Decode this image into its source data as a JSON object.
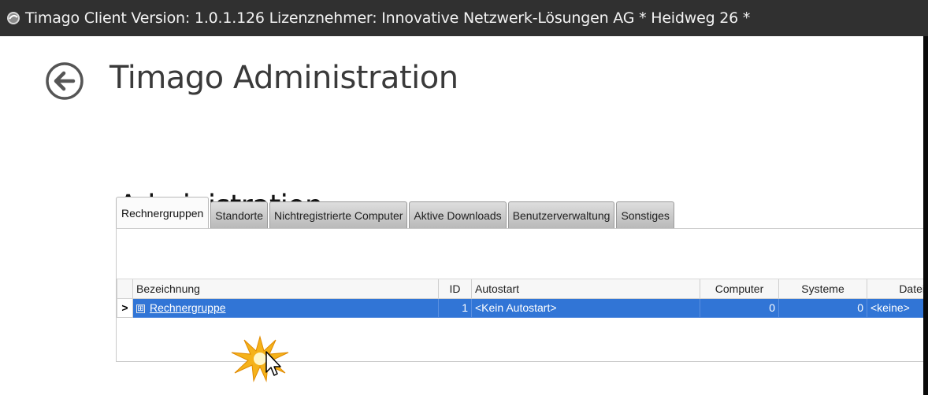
{
  "window": {
    "title": "Timago Client Version: 1.0.1.126   Lizenznehmer: Innovative Netzwerk-Lösungen AG * Heidweg 26 *",
    "app_icon": "timago-app-icon"
  },
  "header": {
    "back_icon": "back-arrow-circle-icon",
    "title": "Timago Administration"
  },
  "section": {
    "title": "Administration"
  },
  "tabs": [
    {
      "label": "Rechnergruppen",
      "active": true
    },
    {
      "label": "Standorte",
      "active": false
    },
    {
      "label": "Nichtregistrierte Computer",
      "active": false
    },
    {
      "label": "Aktive Downloads",
      "active": false
    },
    {
      "label": "Benutzerverwaltung",
      "active": false
    },
    {
      "label": "Sonstiges",
      "active": false
    }
  ],
  "grid": {
    "columns": [
      "Bezeichnung",
      "ID",
      "Autostart",
      "Computer",
      "Systeme",
      "Datei"
    ],
    "rows": [
      {
        "indicator": ">",
        "expand": "⊞",
        "bezeichnung": "Rechnergruppe",
        "id": "1",
        "autostart": "<Kein Autostart>",
        "computer": "0",
        "systeme": "0",
        "datei": "<keine>",
        "selected": true
      }
    ]
  },
  "colors": {
    "titlebar": "#303030",
    "selection": "#3175d6",
    "highlight_star": "#f5b21a"
  }
}
